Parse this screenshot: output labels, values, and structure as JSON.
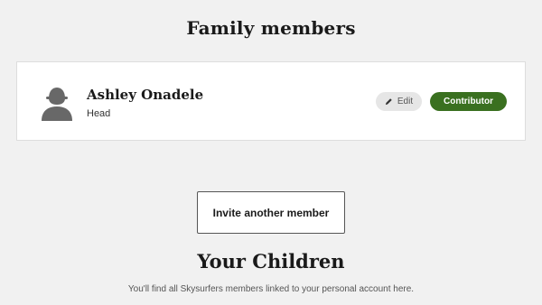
{
  "family_section": {
    "title": "Family members"
  },
  "members": [
    {
      "name": "Ashley Onadele",
      "role": "Head",
      "edit_label": "Edit",
      "badge_label": "Contributor",
      "badge_color": "#3a7020",
      "avatar_icon": "person-silhouette-icon",
      "edit_icon": "pencil-icon"
    }
  ],
  "invite_button": {
    "label": "Invite another member"
  },
  "children_section": {
    "title": "Your Children",
    "description": "You'll find all Skysurfers members linked to your personal account here."
  }
}
